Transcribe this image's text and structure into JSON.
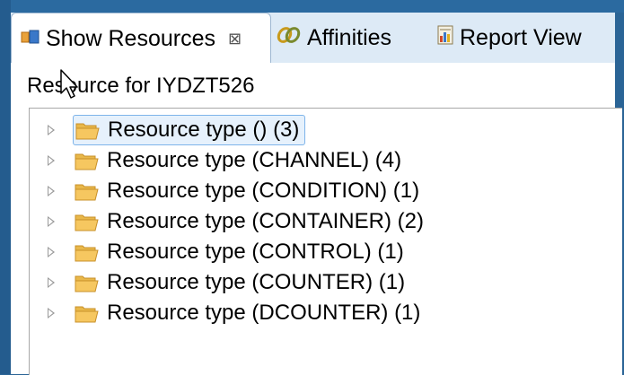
{
  "tabs": [
    {
      "label": "Show Resources",
      "close": "⊠",
      "icon": "resources-icon",
      "active": true
    },
    {
      "label": "Affinities",
      "icon": "affinities-icon",
      "active": false
    },
    {
      "label": "Report View",
      "icon": "report-icon",
      "active": false
    }
  ],
  "view": {
    "title": "Resource for IYDZT526"
  },
  "tree": {
    "items": [
      {
        "label": "Resource type ()  (3)",
        "selected": true
      },
      {
        "label": "Resource type (CHANNEL)  (4)",
        "selected": false
      },
      {
        "label": "Resource type (CONDITION)  (1)",
        "selected": false
      },
      {
        "label": "Resource type (CONTAINER)  (2)",
        "selected": false
      },
      {
        "label": "Resource type (CONTROL)  (1)",
        "selected": false
      },
      {
        "label": "Resource type (COUNTER)  (1)",
        "selected": false
      },
      {
        "label": "Resource type (DCOUNTER)  (1)",
        "selected": false
      }
    ]
  },
  "colors": {
    "frame": "#2a6496",
    "tabbar": "#ddeaf6",
    "selection_bg": "#e6f1fc",
    "selection_border": "#7eb4ea",
    "folder_fill": "#f6c760",
    "folder_edge": "#c8902a"
  }
}
